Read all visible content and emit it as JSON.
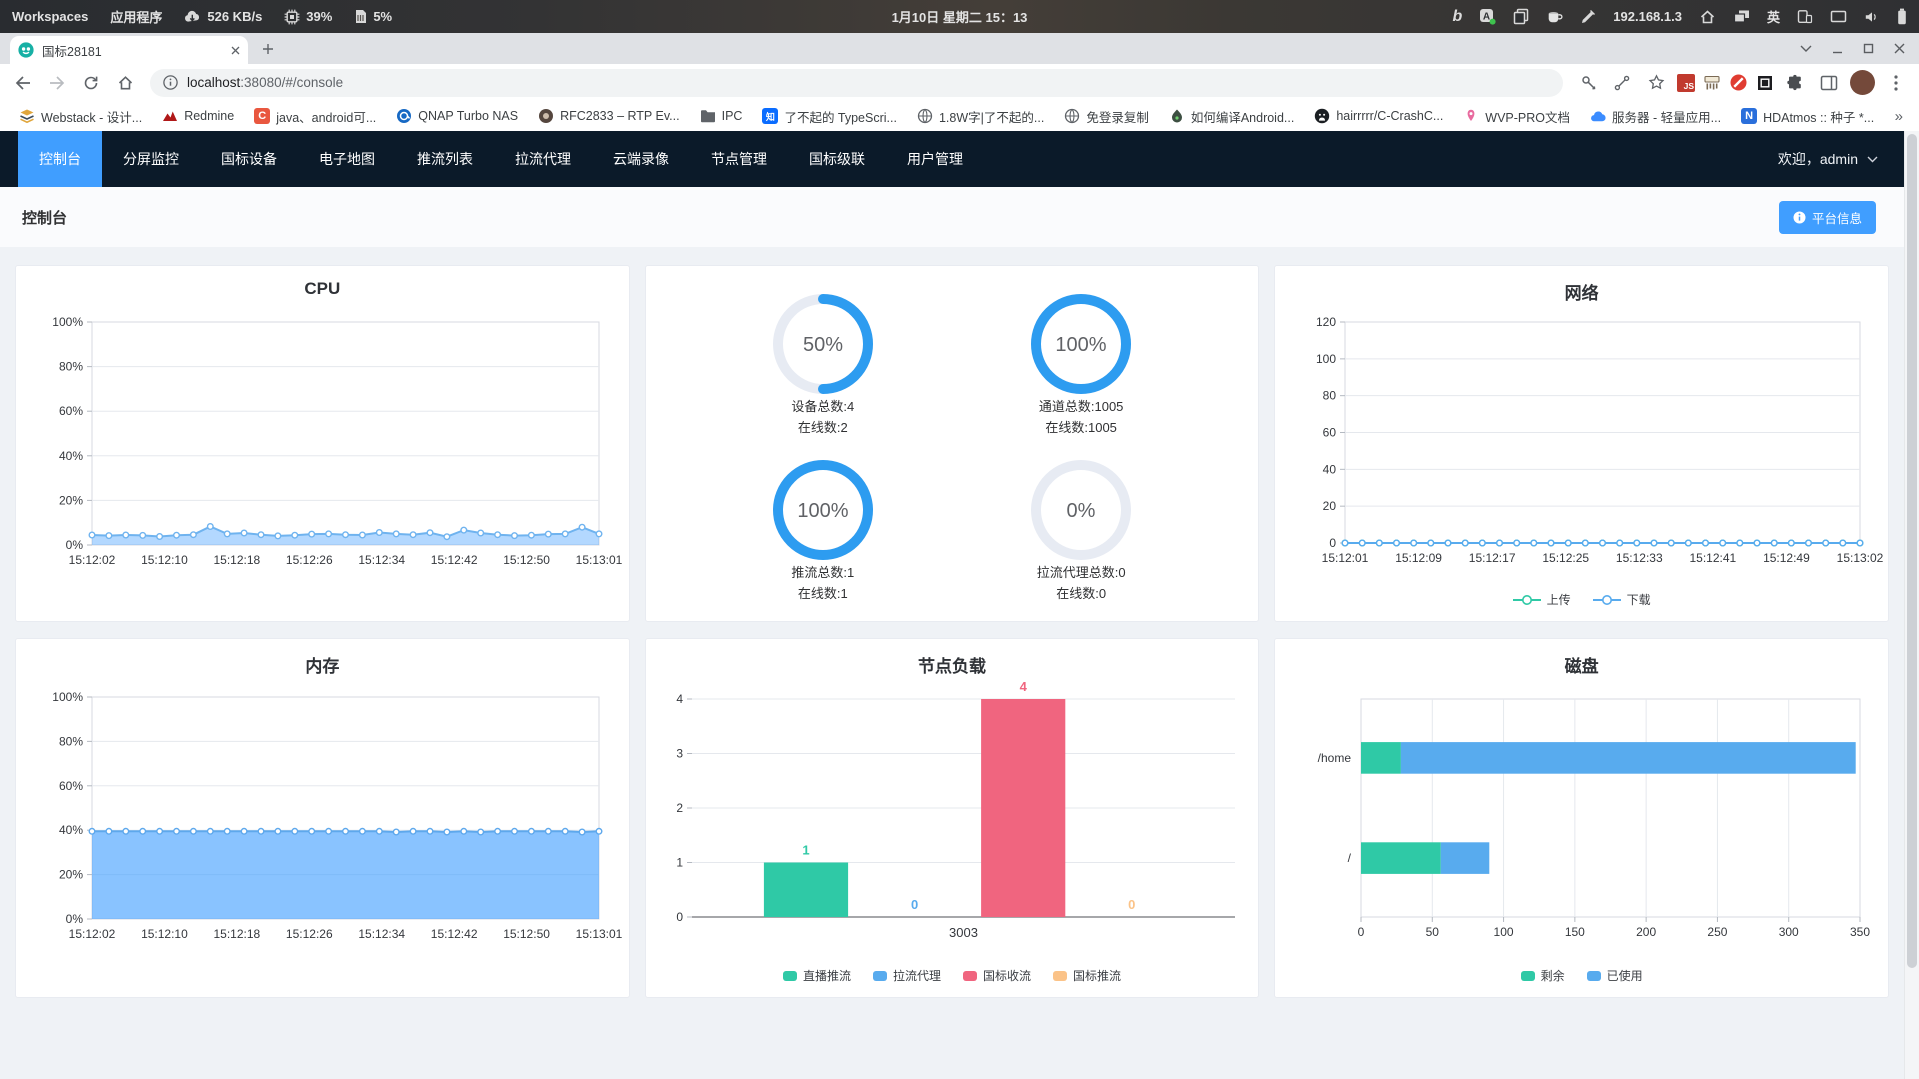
{
  "system_bar": {
    "workspaces_label": "Workspaces",
    "apps_label": "应用程序",
    "net_speed": "526 KB/s",
    "cpu_usage": "39%",
    "mem_usage": "5%",
    "clock": "1月10日 星期二 15：13",
    "ip_address": "192.168.1.3",
    "input_method": "英"
  },
  "browser": {
    "tab_title": "国标28181",
    "url_host": "localhost",
    "url_rest": ":38080/#/console"
  },
  "bookmarks": [
    {
      "label": "Webstack - 设计...",
      "icon": "webstack"
    },
    {
      "label": "Redmine",
      "icon": "redmine"
    },
    {
      "label": "java、android可...",
      "icon": "csdn"
    },
    {
      "label": "QNAP Turbo NAS",
      "icon": "qnap"
    },
    {
      "label": "RFC2833 – RTP Ev...",
      "icon": "rfc"
    },
    {
      "label": "IPC",
      "icon": "folder"
    },
    {
      "label": "了不起的 TypeScri...",
      "icon": "zhihu"
    },
    {
      "label": "1.8W字|了不起的...",
      "icon": "globe"
    },
    {
      "label": "免登录复制",
      "icon": "globe"
    },
    {
      "label": "如何编译Android...",
      "icon": "coolapk"
    },
    {
      "label": "hairrrrr/C-CrashC...",
      "icon": "github"
    },
    {
      "label": "WVP-PRO文档",
      "icon": "wvp"
    },
    {
      "label": "服务器 - 轻量应用...",
      "icon": "cloud"
    },
    {
      "label": "HDAtmos :: 种子 *...",
      "icon": "hdatmos"
    }
  ],
  "bookmarks_overflow": "»",
  "nav": {
    "items": [
      "控制台",
      "分屏监控",
      "国标设备",
      "电子地图",
      "推流列表",
      "拉流代理",
      "云端录像",
      "节点管理",
      "国标级联",
      "用户管理"
    ],
    "active_index": 0,
    "welcome": "欢迎，admin"
  },
  "page": {
    "title": "控制台",
    "platform_info_button": "平台信息"
  },
  "colors": {
    "accent": "#409eff",
    "nav_bg": "#0b1a29",
    "ring_blue": "#2d9cf0",
    "ring_track": "#e7ebf3",
    "green": "#2fc9a6",
    "blue": "#58abee",
    "pink": "#f0657f",
    "orange": "#fbc388"
  },
  "rings": [
    {
      "percent": "50%",
      "value": 50,
      "line1": "设备总数:4",
      "line2": "在线数:2"
    },
    {
      "percent": "100%",
      "value": 100,
      "line1": "通道总数:1005",
      "line2": "在线数:1005"
    },
    {
      "percent": "100%",
      "value": 100,
      "line1": "推流总数:1",
      "line2": "在线数:1"
    },
    {
      "percent": "0%",
      "value": 0,
      "line1": "拉流代理总数:0",
      "line2": "在线数:0"
    }
  ],
  "chart_data": [
    {
      "id": "cpu",
      "type": "area",
      "title": "CPU",
      "ylim": [
        0,
        100
      ],
      "ytick_labels": [
        "0%",
        "20%",
        "40%",
        "60%",
        "80%",
        "100%"
      ],
      "xticks": [
        "15:12:02",
        "15:12:10",
        "15:12:18",
        "15:12:26",
        "15:12:34",
        "15:12:42",
        "15:12:50",
        "15:13:01"
      ],
      "line_color": "#6fb3ef",
      "fill_color": "rgba(64,158,255,0.40)",
      "values": [
        4.5,
        4.2,
        4.5,
        4.3,
        3.8,
        4.4,
        4.6,
        8.3,
        5.0,
        5.4,
        4.6,
        4.1,
        4.4,
        4.9,
        5.0,
        4.6,
        4.5,
        5.6,
        5.0,
        4.6,
        5.5,
        3.7,
        6.7,
        5.4,
        4.6,
        4.2,
        4.4,
        4.9,
        5.0,
        8.0,
        5.0
      ]
    },
    {
      "id": "network",
      "type": "line",
      "title": "网络",
      "ylim": [
        0,
        120
      ],
      "ytick_labels": [
        "0",
        "20",
        "40",
        "60",
        "80",
        "100",
        "120"
      ],
      "xticks": [
        "15:12:01",
        "15:12:09",
        "15:12:17",
        "15:12:25",
        "15:12:33",
        "15:12:41",
        "15:12:49",
        "15:13:02"
      ],
      "legend_type": "line",
      "series": [
        {
          "name": "上传",
          "color": "#2fc9a6",
          "values": [
            0,
            0,
            0,
            0,
            0,
            0,
            0,
            0,
            0,
            0,
            0,
            0,
            0,
            0,
            0,
            0,
            0,
            0,
            0,
            0,
            0,
            0,
            0,
            0,
            0,
            0,
            0,
            0,
            0,
            0,
            0
          ]
        },
        {
          "name": "下载",
          "color": "#58abee",
          "values": [
            0,
            0,
            0,
            0,
            0,
            0,
            0,
            0,
            0,
            0,
            0,
            0,
            0,
            0,
            0,
            0,
            0,
            0,
            0,
            0,
            0,
            0,
            0,
            0,
            0,
            0,
            0,
            0,
            0,
            0,
            0
          ]
        }
      ]
    },
    {
      "id": "memory",
      "type": "area",
      "title": "内存",
      "ylim": [
        0,
        100
      ],
      "ytick_labels": [
        "0%",
        "20%",
        "40%",
        "60%",
        "80%",
        "100%"
      ],
      "xticks": [
        "15:12:02",
        "15:12:10",
        "15:12:18",
        "15:12:26",
        "15:12:34",
        "15:12:42",
        "15:12:50",
        "15:13:01"
      ],
      "line_color": "#5ea8ec",
      "fill_color": "rgba(64,158,255,0.62)",
      "values": [
        39.5,
        39.5,
        39.5,
        39.5,
        39.5,
        39.5,
        39.5,
        39.5,
        39.5,
        39.5,
        39.5,
        39.5,
        39.5,
        39.5,
        39.5,
        39.5,
        39.5,
        39.5,
        39.2,
        39.5,
        39.5,
        39.2,
        39.5,
        39.2,
        39.5,
        39.5,
        39.5,
        39.5,
        39.5,
        39.2,
        39.5
      ]
    },
    {
      "id": "node_load",
      "type": "bar",
      "title": "节点负载",
      "categories": [
        "3003"
      ],
      "ylim": [
        0,
        4
      ],
      "ytick_labels": [
        "0",
        "1",
        "2",
        "3",
        "4"
      ],
      "legend_type": "rect",
      "series": [
        {
          "name": "直播推流",
          "color": "#2fc9a6",
          "values": [
            1
          ]
        },
        {
          "name": "拉流代理",
          "color": "#58abee",
          "values": [
            0
          ]
        },
        {
          "name": "国标收流",
          "color": "#f0657f",
          "values": [
            4
          ]
        },
        {
          "name": "国标推流",
          "color": "#fbc388",
          "values": [
            0
          ]
        }
      ]
    },
    {
      "id": "disk",
      "type": "stacked-hbar",
      "title": "磁盘",
      "categories": [
        "/home",
        "/"
      ],
      "xlim": [
        0,
        350
      ],
      "xtick_labels": [
        "0",
        "50",
        "100",
        "150",
        "200",
        "250",
        "300",
        "350"
      ],
      "legend_type": "rect",
      "series": [
        {
          "name": "剩余",
          "color": "#2fc9a6",
          "values": [
            28,
            56
          ]
        },
        {
          "name": "已使用",
          "color": "#58abee",
          "values": [
            319,
            34
          ]
        }
      ]
    }
  ]
}
